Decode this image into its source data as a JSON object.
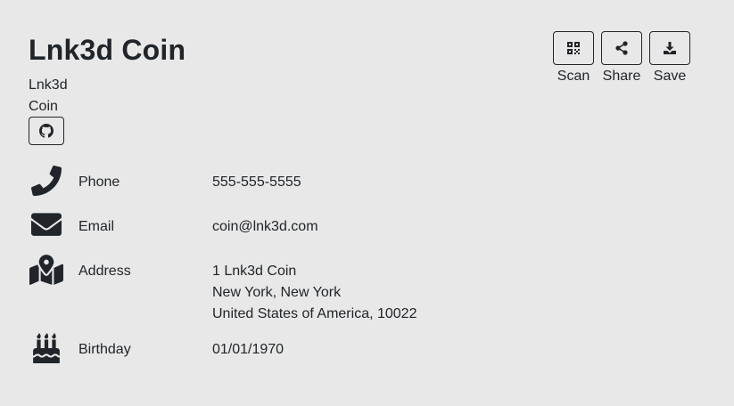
{
  "card": {
    "name": "Lnk3d Coin",
    "org_line1": "Lnk3d",
    "org_line2": "Coin"
  },
  "actions": {
    "scan_label": "Scan",
    "share_label": "Share",
    "save_label": "Save"
  },
  "social": {
    "github_icon": "github-icon"
  },
  "details": {
    "phone": {
      "label": "Phone",
      "value": "555-555-5555",
      "icon": "phone-icon"
    },
    "email": {
      "label": "Email",
      "value": "coin@lnk3d.com",
      "icon": "envelope-icon"
    },
    "address": {
      "label": "Address",
      "line1": "1 Lnk3d Coin",
      "line2": "New York, New York",
      "line3": "United States of America, 10022",
      "icon": "map-icon"
    },
    "birthday": {
      "label": "Birthday",
      "value": "01/01/1970",
      "icon": "birthday-cake-icon"
    }
  },
  "colors": {
    "background": "#e8e8e8",
    "text": "#212529"
  }
}
